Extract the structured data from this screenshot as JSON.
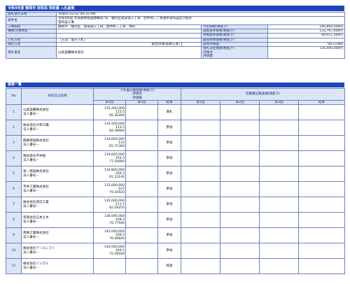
{
  "header": {
    "title": "令和4年度 静岡市 財政局 契約課 入札結果"
  },
  "info": {
    "labels": {
      "date": "開札執行日時",
      "name": "案件名",
      "place": "工事箇所",
      "class": "種類/対象地区",
      "method": "入札方式",
      "decision": "落札方式",
      "winner": "落札者名",
      "estimate": "予定価格(税抜き)",
      "inspect": "調査基準価格(税抜き)",
      "lowlimit": "失格基準価格(税抜き)",
      "minscore": "最低制限価格(税抜き)",
      "basescore": "基準評価値",
      "winprice": "落札決定金額(税抜き)",
      "winscore": "評価点",
      "winvalue": "評価値"
    },
    "values": {
      "date": "令和05-03-02 09:10 AM",
      "name_line1": "令和4年度 水道基幹施設整備第7号　駿河区南安倍三丁目・西中原二丁目送水管布設及び配水",
      "name_line2": "管布設工事",
      "place": "静岡市　駿河区　南安倍三丁目、西中原二丁目　地内",
      "class": "",
      "method": "（方法：電子入札）",
      "decision": "総合評価(加算方式)",
      "winner": "山武設備株式会社",
      "estimate": "146,800,000円",
      "inspect": "133,767,000円",
      "lowlimit": "99,011,000円",
      "minscore": "",
      "basescore": "68.11980",
      "winprice": "135,400,000円"
    }
  },
  "bidders_bar": "業者一覧",
  "table": {
    "headers": {
      "no": "No",
      "company": "商号又は名称",
      "bid_group": "入札書記載金額(税抜き)\n評価点\n評価値",
      "re_group": "見積書記載金額(税抜き)",
      "round1": "第1回",
      "round2": "第2回",
      "round3": "第3回",
      "result": "結果"
    },
    "rows": [
      {
        "no": "1",
        "company": "山武設備株式会社",
        "rep": "法人番号－",
        "amount": "135,400,000",
        "score": "115.5",
        "value": "85.30280",
        "result": "落札"
      },
      {
        "no": "2",
        "company": "株式会社大和工機",
        "rep": "法人番号－",
        "amount": "134,500,000",
        "score": "113.5",
        "value": "84.38660",
        "result": "参加"
      },
      {
        "no": "3",
        "company": "静鉄建設株式会社",
        "rep": "法人番号－",
        "amount": "134,600,000",
        "score": "110",
        "value": "81.72360",
        "result": "参加"
      },
      {
        "no": "4",
        "company": "株式会社平井組",
        "rep": "法人番号－",
        "amount": "134,665,000",
        "score": "104.5",
        "value": "77.59990",
        "result": "参加"
      },
      {
        "no": "5",
        "company": "第一建設株式会社",
        "rep": "法人番号－",
        "amount": "134,800,000",
        "score": "109.5",
        "value": "81.23140",
        "result": "参加"
      },
      {
        "no": "6",
        "company": "平井工業株式会社",
        "rep": "法人番号－",
        "amount": "135,000,000",
        "score": "107",
        "value": "79.25920",
        "result": "参加"
      },
      {
        "no": "7",
        "company": "株式会社渡辺工業",
        "rep": "法人番号－",
        "amount": "135,000,000",
        "score": "111.5",
        "value": "82.59250",
        "result": "参加"
      },
      {
        "no": "8",
        "company": "有限会社石本土木",
        "rep": "法人番号－",
        "amount": "136,000,000",
        "score": "108.5",
        "value": "79.77940",
        "result": "参加"
      },
      {
        "no": "9",
        "company": "南條工業株式会社",
        "rep": "法人番号－",
        "amount": "142,000,000",
        "score": "108.5",
        "value": "76.40840",
        "result": "参加"
      },
      {
        "no": "10",
        "company": "株式会社アースシフト",
        "rep": "法人番号－",
        "amount": "144,000,000",
        "score": "104.5",
        "value": "72.56940",
        "result": "参加"
      },
      {
        "no": "11",
        "company": "株式会社イシガミ",
        "rep": "法人番号－",
        "amount": "",
        "score": "",
        "value": "",
        "result": "辞退"
      }
    ]
  }
}
